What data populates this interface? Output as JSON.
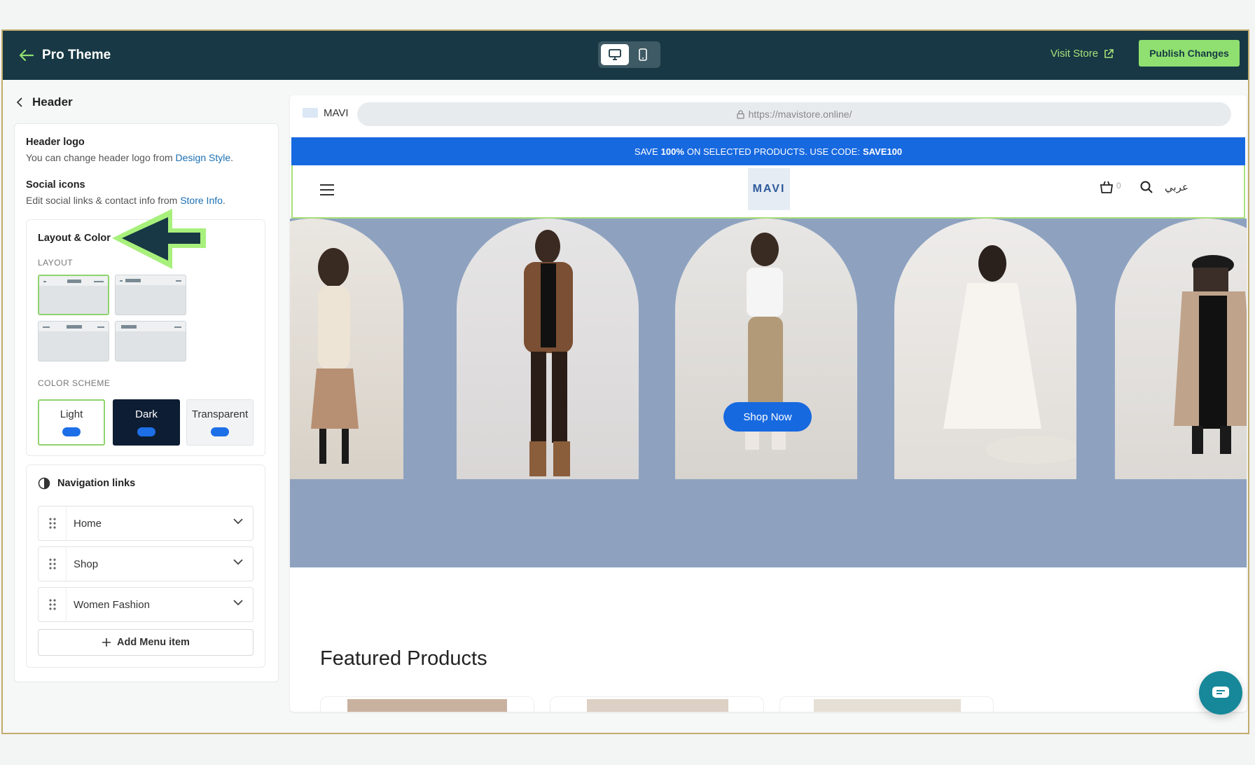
{
  "topbar": {
    "title": "Pro Theme",
    "visit_store": "Visit Store",
    "publish": "Publish Changes",
    "device_modes": [
      "desktop-icon",
      "mobile-icon"
    ],
    "active_device": "desktop"
  },
  "sidebar": {
    "back_label": "Header",
    "header_logo": {
      "title": "Header logo",
      "desc": "You can change header logo from ",
      "link": "Design Style",
      "end": "."
    },
    "social_icons": {
      "title": "Social icons",
      "desc": "Edit social links & contact info from ",
      "link": "Store Info",
      "end": "."
    },
    "layout_color": {
      "title": "Layout & Color",
      "layout_label": "LAYOUT",
      "scheme_label": "COLOR SCHEME",
      "schemes": [
        "Light",
        "Dark",
        "Transparent"
      ],
      "selected_scheme": "Light",
      "selected_layout": 1
    },
    "navigation": {
      "title": "Navigation links",
      "items": [
        "Home",
        "Shop",
        "Women Fashion"
      ],
      "add_label": "Add Menu item"
    }
  },
  "preview": {
    "site_name": "MAVI",
    "url": "https://mavistore.online/",
    "promo_prefix": "SAVE",
    "promo_bold1": "100%",
    "promo_mid": "ON SELECTED PRODUCTS. USE CODE:",
    "promo_code": "SAVE100",
    "logo_text": "MAVI",
    "cart_count": "0",
    "lang": "عربي",
    "shop_now": "Shop Now",
    "featured_title": "Featured Products"
  },
  "colors": {
    "topbar": "#173844",
    "accent_green": "#8fe070",
    "promo_blue": "#1769e0",
    "hero_bg": "#8ea2c0",
    "dark_scheme": "#0d1d33"
  }
}
